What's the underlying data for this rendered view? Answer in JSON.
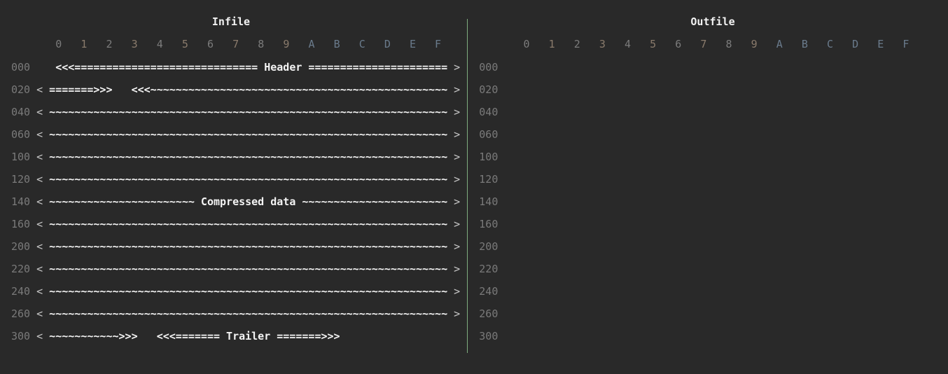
{
  "infile": {
    "title": "Infile",
    "columns": [
      "0",
      "1",
      "2",
      "3",
      "4",
      "5",
      "6",
      "7",
      "8",
      "9",
      "A",
      "B",
      "C",
      "D",
      "E",
      "F"
    ],
    "rows": [
      {
        "offset": "000",
        "left": "",
        "content": "<<<============================= Header ======================",
        "right": ">"
      },
      {
        "offset": "020",
        "left": "<",
        "content": "=======>>>   <<<~~~~~~~~~~~~~~~~~~~~~~~~~~~~~~~~~~~~~~~~~~~~~~~",
        "right": ">"
      },
      {
        "offset": "040",
        "left": "<",
        "content": "~~~~~~~~~~~~~~~~~~~~~~~~~~~~~~~~~~~~~~~~~~~~~~~~~~~~~~~~~~~~~~~",
        "right": ">"
      },
      {
        "offset": "060",
        "left": "<",
        "content": "~~~~~~~~~~~~~~~~~~~~~~~~~~~~~~~~~~~~~~~~~~~~~~~~~~~~~~~~~~~~~~~",
        "right": ">"
      },
      {
        "offset": "100",
        "left": "<",
        "content": "~~~~~~~~~~~~~~~~~~~~~~~~~~~~~~~~~~~~~~~~~~~~~~~~~~~~~~~~~~~~~~~",
        "right": ">"
      },
      {
        "offset": "120",
        "left": "<",
        "content": "~~~~~~~~~~~~~~~~~~~~~~~~~~~~~~~~~~~~~~~~~~~~~~~~~~~~~~~~~~~~~~~",
        "right": ">"
      },
      {
        "offset": "140",
        "left": "<",
        "content": "~~~~~~~~~~~~~~~~~~~~~~~ Compressed data ~~~~~~~~~~~~~~~~~~~~~~~",
        "right": ">"
      },
      {
        "offset": "160",
        "left": "<",
        "content": "~~~~~~~~~~~~~~~~~~~~~~~~~~~~~~~~~~~~~~~~~~~~~~~~~~~~~~~~~~~~~~~",
        "right": ">"
      },
      {
        "offset": "200",
        "left": "<",
        "content": "~~~~~~~~~~~~~~~~~~~~~~~~~~~~~~~~~~~~~~~~~~~~~~~~~~~~~~~~~~~~~~~",
        "right": ">"
      },
      {
        "offset": "220",
        "left": "<",
        "content": "~~~~~~~~~~~~~~~~~~~~~~~~~~~~~~~~~~~~~~~~~~~~~~~~~~~~~~~~~~~~~~~",
        "right": ">"
      },
      {
        "offset": "240",
        "left": "<",
        "content": "~~~~~~~~~~~~~~~~~~~~~~~~~~~~~~~~~~~~~~~~~~~~~~~~~~~~~~~~~~~~~~~",
        "right": ">"
      },
      {
        "offset": "260",
        "left": "<",
        "content": "~~~~~~~~~~~~~~~~~~~~~~~~~~~~~~~~~~~~~~~~~~~~~~~~~~~~~~~~~~~~~~~",
        "right": ">"
      },
      {
        "offset": "300",
        "left": "<",
        "content": "~~~~~~~~~~~>>>   <<<======= Trailer =======>>>",
        "right": ""
      }
    ]
  },
  "outfile": {
    "title": "Outfile",
    "columns": [
      "0",
      "1",
      "2",
      "3",
      "4",
      "5",
      "6",
      "7",
      "8",
      "9",
      "A",
      "B",
      "C",
      "D",
      "E",
      "F"
    ],
    "offsets": [
      "000",
      "020",
      "040",
      "060",
      "100",
      "120",
      "140",
      "160",
      "200",
      "220",
      "240",
      "260",
      "300"
    ]
  },
  "colors": {
    "background": "#292929",
    "separator": "#7fae7f",
    "content": "#f4f4f4",
    "offset": "#7a7a7a"
  }
}
